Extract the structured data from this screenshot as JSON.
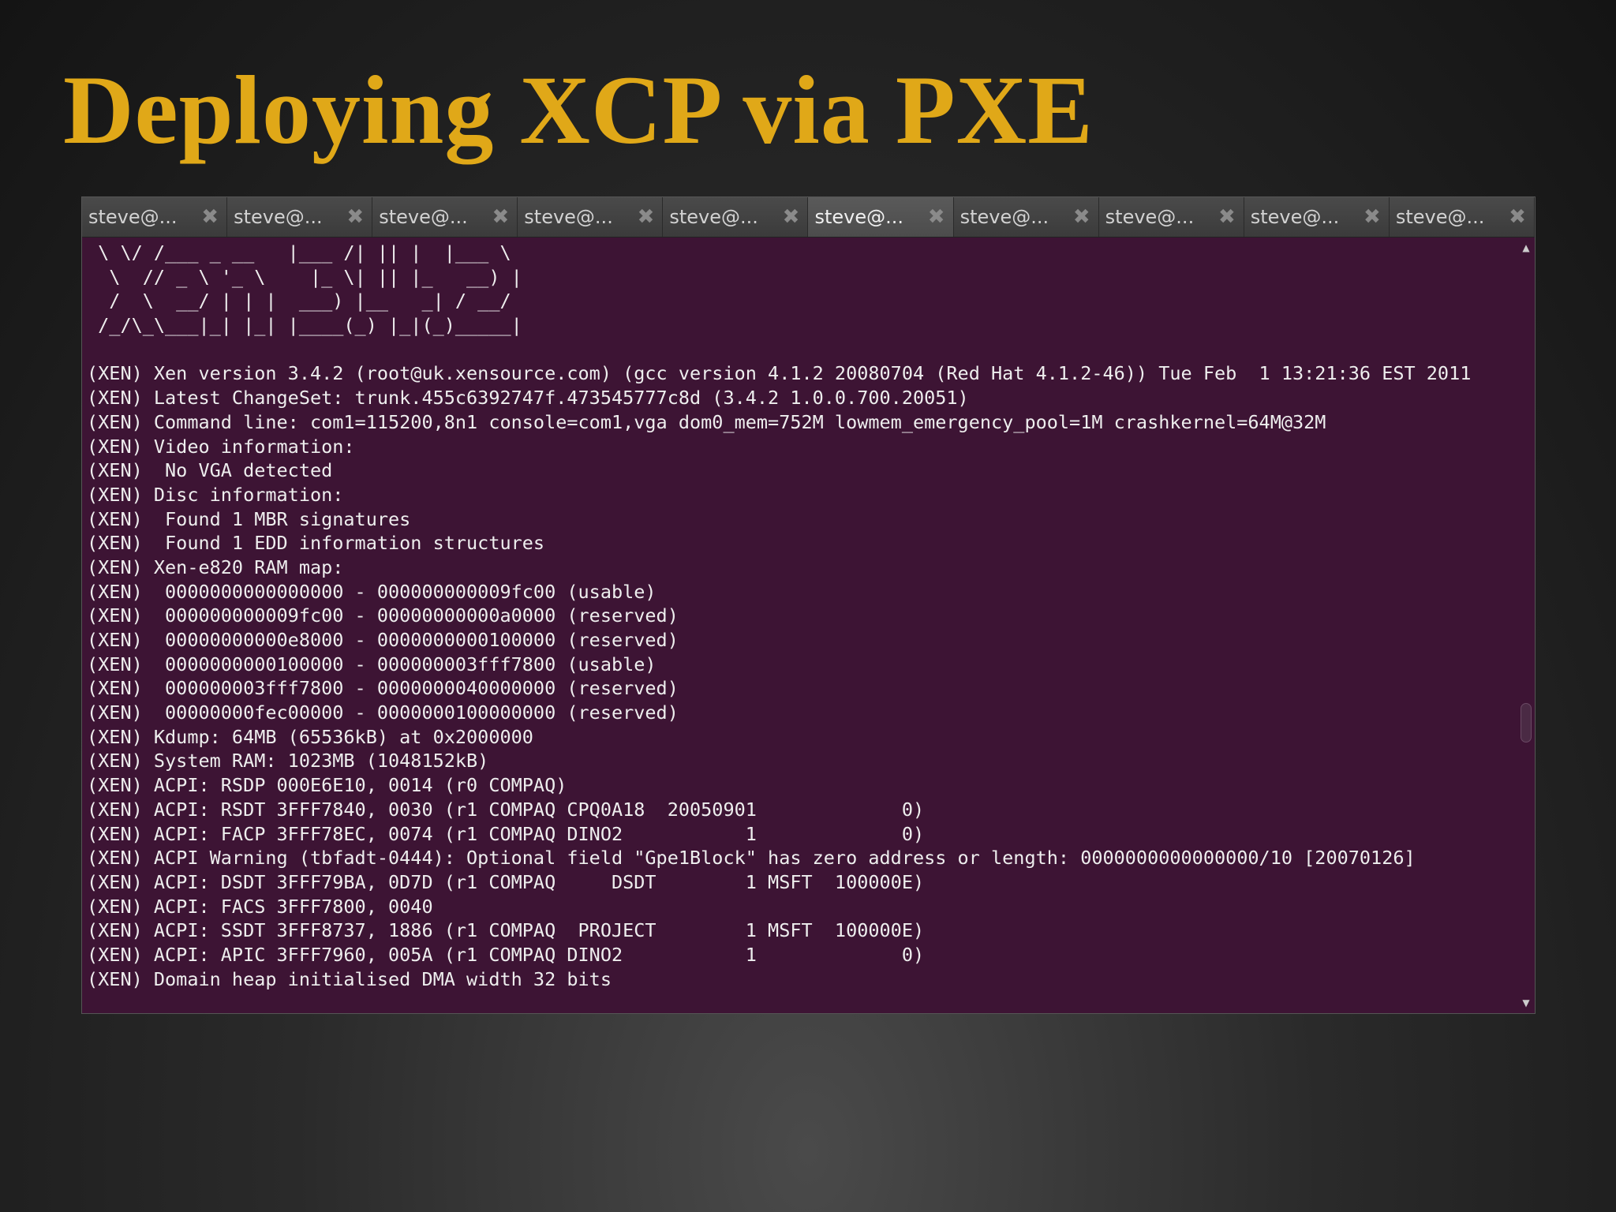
{
  "slide": {
    "title": "Deploying XCP via PXE"
  },
  "tabs": [
    {
      "label": "steve@...",
      "active": false
    },
    {
      "label": "steve@...",
      "active": false
    },
    {
      "label": "steve@...",
      "active": false
    },
    {
      "label": "steve@...",
      "active": false
    },
    {
      "label": "steve@...",
      "active": false
    },
    {
      "label": "steve@...",
      "active": true
    },
    {
      "label": "steve@...",
      "active": false
    },
    {
      "label": "steve@...",
      "active": false
    },
    {
      "label": "steve@...",
      "active": false
    },
    {
      "label": "steve@...",
      "active": false
    }
  ],
  "icons": {
    "tab_close": "close-icon",
    "scroll_up": "arrow-up-icon",
    "scroll_down": "arrow-down-icon"
  },
  "colors": {
    "title": "#e0a818",
    "terminal_bg": "#3d1434",
    "terminal_fg": "#eeeeee"
  },
  "terminal": {
    "lines": [
      " \\ \\/ /___ _ __   |___ /| || |  |___ \\",
      "  \\  // _ \\ '_ \\    |_ \\| || |_   __) |",
      "  /  \\  __/ | | |  ___) |__   _| / __/",
      " /_/\\_\\___|_| |_| |____(_) |_|(_)_____|",
      "",
      "(XEN) Xen version 3.4.2 (root@uk.xensource.com) (gcc version 4.1.2 20080704 (Red Hat 4.1.2-46)) Tue Feb  1 13:21:36 EST 2011",
      "(XEN) Latest ChangeSet: trunk.455c6392747f.473545777c8d (3.4.2 1.0.0.700.20051)",
      "(XEN) Command line: com1=115200,8n1 console=com1,vga dom0_mem=752M lowmem_emergency_pool=1M crashkernel=64M@32M",
      "(XEN) Video information:",
      "(XEN)  No VGA detected",
      "(XEN) Disc information:",
      "(XEN)  Found 1 MBR signatures",
      "(XEN)  Found 1 EDD information structures",
      "(XEN) Xen-e820 RAM map:",
      "(XEN)  0000000000000000 - 000000000009fc00 (usable)",
      "(XEN)  000000000009fc00 - 00000000000a0000 (reserved)",
      "(XEN)  00000000000e8000 - 0000000000100000 (reserved)",
      "(XEN)  0000000000100000 - 000000003fff7800 (usable)",
      "(XEN)  000000003fff7800 - 0000000040000000 (reserved)",
      "(XEN)  00000000fec00000 - 0000000100000000 (reserved)",
      "(XEN) Kdump: 64MB (65536kB) at 0x2000000",
      "(XEN) System RAM: 1023MB (1048152kB)",
      "(XEN) ACPI: RSDP 000E6E10, 0014 (r0 COMPAQ)",
      "(XEN) ACPI: RSDT 3FFF7840, 0030 (r1 COMPAQ CPQ0A18  20050901             0)",
      "(XEN) ACPI: FACP 3FFF78EC, 0074 (r1 COMPAQ DINO2           1             0)",
      "(XEN) ACPI Warning (tbfadt-0444): Optional field \"Gpe1Block\" has zero address or length: 0000000000000000/10 [20070126]",
      "(XEN) ACPI: DSDT 3FFF79BA, 0D7D (r1 COMPAQ     DSDT        1 MSFT  100000E)",
      "(XEN) ACPI: FACS 3FFF7800, 0040",
      "(XEN) ACPI: SSDT 3FFF8737, 1886 (r1 COMPAQ  PROJECT        1 MSFT  100000E)",
      "(XEN) ACPI: APIC 3FFF7960, 005A (r1 COMPAQ DINO2           1             0)",
      "(XEN) Domain heap initialised DMA width 32 bits"
    ]
  }
}
